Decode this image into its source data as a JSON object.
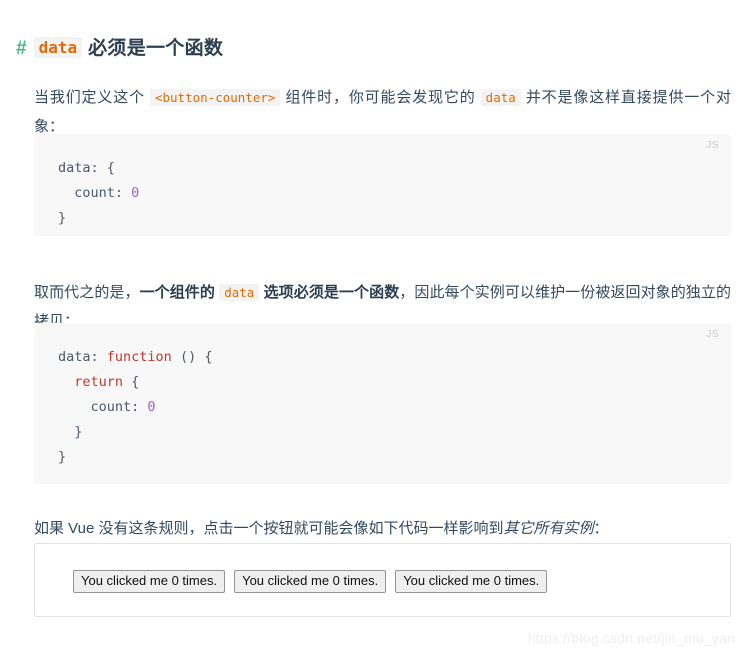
{
  "heading": {
    "anchor": "#",
    "code": "data",
    "text": "必须是一个函数"
  },
  "paragraphs": {
    "p1": {
      "seg1": "当我们定义这个",
      "code1": "<button-counter>",
      "seg2": "组件时，你可能会发现它的",
      "code2": "data",
      "seg3": "并不是像这样直接提供一个对象："
    },
    "p2": {
      "seg1": "取而代之的是，",
      "bold1": "一个组件的",
      "code1": "data",
      "bold2": "选项必须是一个函数",
      "seg2": "，因此每个实例可以维护一份被返回对象的独立的拷贝："
    },
    "p3": {
      "seg1": "如果 Vue 没有这条规则，点击一个按钮就可能会像如下代码一样影响到",
      "italic1": "其它所有实例",
      "seg2": "："
    }
  },
  "code_blocks": [
    {
      "lang_label": "JS",
      "lines": [
        {
          "parts": [
            {
              "t": "data: {",
              "c": "tok-pl"
            }
          ]
        },
        {
          "parts": [
            {
              "t": "  count: ",
              "c": "tok-pl"
            },
            {
              "t": "0",
              "c": "tok-num"
            }
          ]
        },
        {
          "parts": [
            {
              "t": "}",
              "c": "tok-pl"
            }
          ]
        }
      ]
    },
    {
      "lang_label": "JS",
      "lines": [
        {
          "parts": [
            {
              "t": "data: ",
              "c": "tok-pl"
            },
            {
              "t": "function",
              "c": "tok-kw"
            },
            {
              "t": " () {",
              "c": "tok-pl"
            }
          ]
        },
        {
          "parts": [
            {
              "t": "  ",
              "c": "tok-pl"
            },
            {
              "t": "return",
              "c": "tok-kw"
            },
            {
              "t": " {",
              "c": "tok-pl"
            }
          ]
        },
        {
          "parts": [
            {
              "t": "    count: ",
              "c": "tok-pl"
            },
            {
              "t": "0",
              "c": "tok-num"
            }
          ]
        },
        {
          "parts": [
            {
              "t": "  }",
              "c": "tok-pl"
            }
          ]
        },
        {
          "parts": [
            {
              "t": "}",
              "c": "tok-pl"
            }
          ]
        }
      ]
    }
  ],
  "demo": {
    "buttons": [
      "You clicked me 0 times.",
      "You clicked me 0 times.",
      "You clicked me 0 times."
    ]
  },
  "watermark": "https://blog.csdn.net/jin_mu_yan",
  "colors": {
    "anchor_green": "#42b983",
    "inline_code_orange": "#e96900",
    "keyword_red": "#c0392b",
    "number_purple": "#a45bd4",
    "code_bg": "#f8f8f8",
    "body_text": "#34495e"
  }
}
